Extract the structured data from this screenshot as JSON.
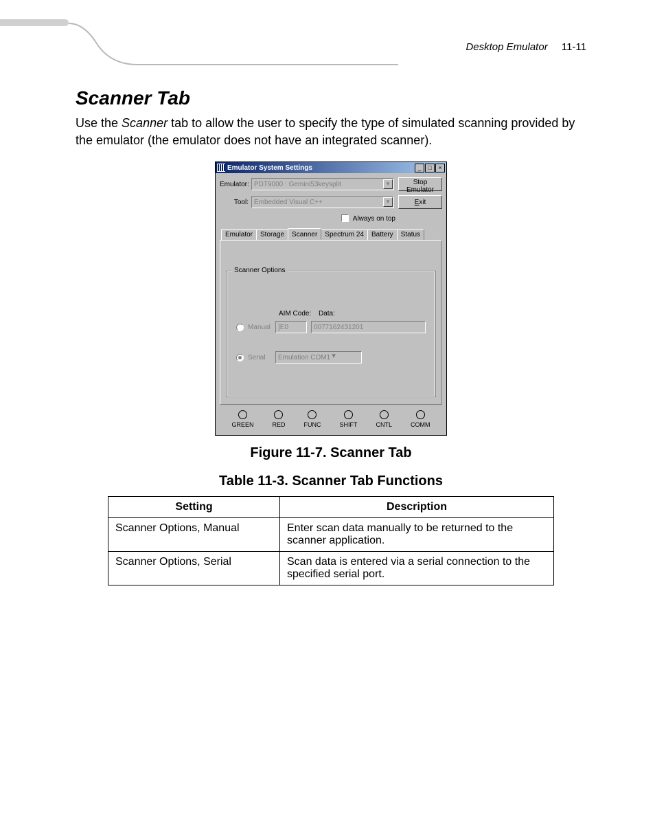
{
  "header": {
    "doc_title": "Desktop Emulator",
    "page_num": "11-11"
  },
  "section": {
    "title": "Scanner Tab",
    "intro_pre": "Use the ",
    "intro_em": "Scanner",
    "intro_post": " tab to allow the user to specify the type of simulated scanning provided by the emulator (the emulator does not have an integrated scanner)."
  },
  "figure_caption": "Figure 11-7.  Scanner Tab",
  "table_caption": "Table 11-3. Scanner Tab Functions",
  "window": {
    "title": "Emulator System Settings",
    "emulator_label": "Emulator:",
    "emulator_value": "PDT9000 : Gemini53keysplit",
    "tool_label": "Tool:",
    "tool_value": "Embedded Visual C++",
    "stop_btn": "Stop Emulator",
    "exit_btn": "Exit",
    "always_on_top": "Always on top",
    "tabs": [
      "Emulator",
      "Storage",
      "Scanner",
      "Spectrum 24",
      "Battery",
      "Status"
    ],
    "active_tab_index": 2,
    "group_label": "Scanner Options",
    "aim_label": "AIM Code:",
    "data_label": "Data:",
    "manual_label": "Manual",
    "aim_value": "]E0",
    "data_value": "0077162431201",
    "serial_label": "Serial",
    "serial_value": "Emulation COM1",
    "leds": [
      "GREEN",
      "RED",
      "FUNC",
      "SHIFT",
      "CNTL",
      "COMM"
    ]
  },
  "table": {
    "headers": {
      "setting": "Setting",
      "description": "Description"
    },
    "rows": [
      {
        "setting": "Scanner Options, Manual",
        "description": "Enter scan data manually to be returned to the scanner application."
      },
      {
        "setting": "Scanner Options, Serial",
        "description": "Scan data is entered via a serial connection to the specified serial port."
      }
    ]
  }
}
